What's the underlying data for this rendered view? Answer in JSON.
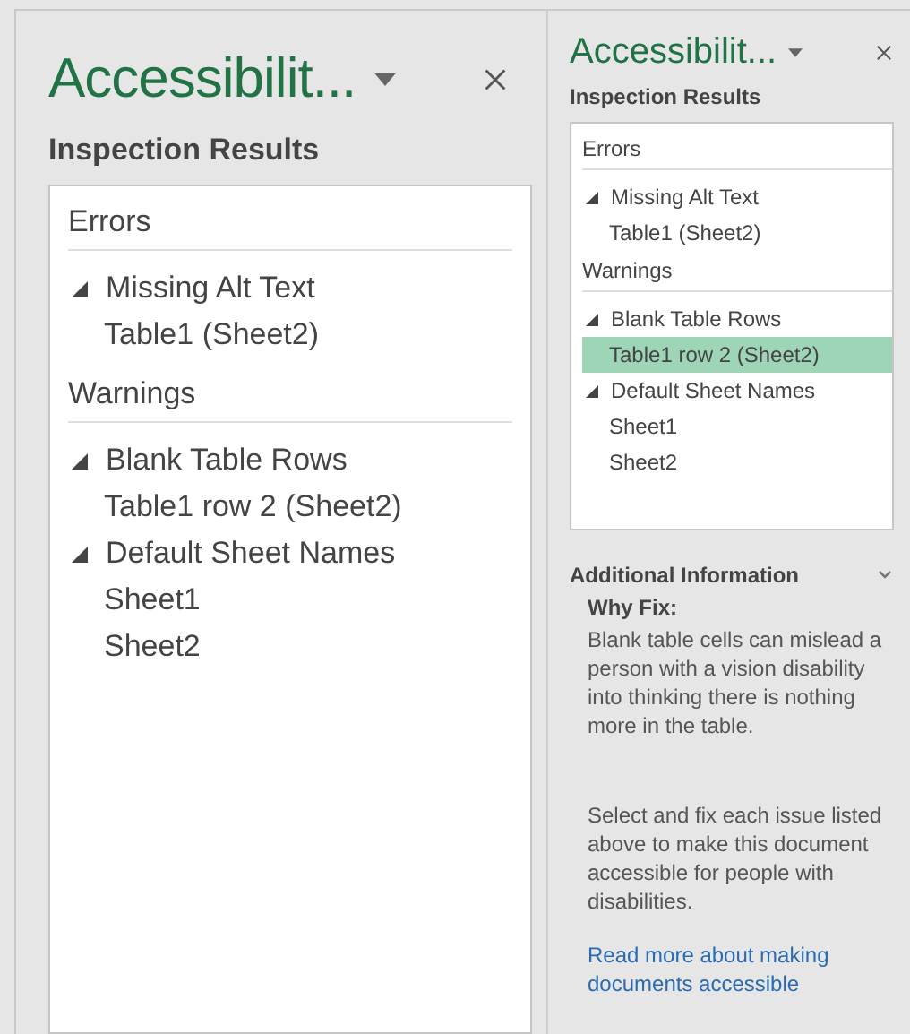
{
  "panels": [
    {
      "title": "Accessibilit...",
      "subtitle": "Inspection Results",
      "groups": [
        {
          "heading": "Errors",
          "issues": [
            {
              "label": "Missing Alt Text",
              "expanded": true,
              "children": [
                {
                  "label": "Table1 (Sheet2)",
                  "selected": false
                }
              ]
            }
          ]
        },
        {
          "heading": "Warnings",
          "issues": [
            {
              "label": "Blank Table Rows",
              "expanded": true,
              "children": [
                {
                  "label": "Table1 row 2 (Sheet2)",
                  "selected": false
                }
              ]
            },
            {
              "label": "Default Sheet Names",
              "expanded": true,
              "children": [
                {
                  "label": "Sheet1",
                  "selected": false
                },
                {
                  "label": "Sheet2",
                  "selected": false
                }
              ]
            }
          ]
        }
      ]
    },
    {
      "title": "Accessibilit...",
      "subtitle": "Inspection Results",
      "groups": [
        {
          "heading": "Errors",
          "issues": [
            {
              "label": "Missing Alt Text",
              "expanded": true,
              "children": [
                {
                  "label": "Table1 (Sheet2)",
                  "selected": false
                }
              ]
            }
          ]
        },
        {
          "heading": "Warnings",
          "issues": [
            {
              "label": "Blank Table Rows",
              "expanded": true,
              "children": [
                {
                  "label": "Table1 row 2 (Sheet2)",
                  "selected": true
                }
              ]
            },
            {
              "label": "Default Sheet Names",
              "expanded": true,
              "children": [
                {
                  "label": "Sheet1",
                  "selected": false
                },
                {
                  "label": "Sheet2",
                  "selected": false
                }
              ]
            }
          ]
        }
      ],
      "additional_info": {
        "heading": "Additional Information",
        "expanded": true,
        "why_fix_label": "Why Fix:",
        "why_fix_text": "Blank table cells can mislead a person with a vision disability into thinking there is nothing more in the table.",
        "guidance": "Select and fix each issue listed above to make this document accessible for people with disabilities.",
        "link": "Read more about making documents accessible"
      }
    }
  ]
}
